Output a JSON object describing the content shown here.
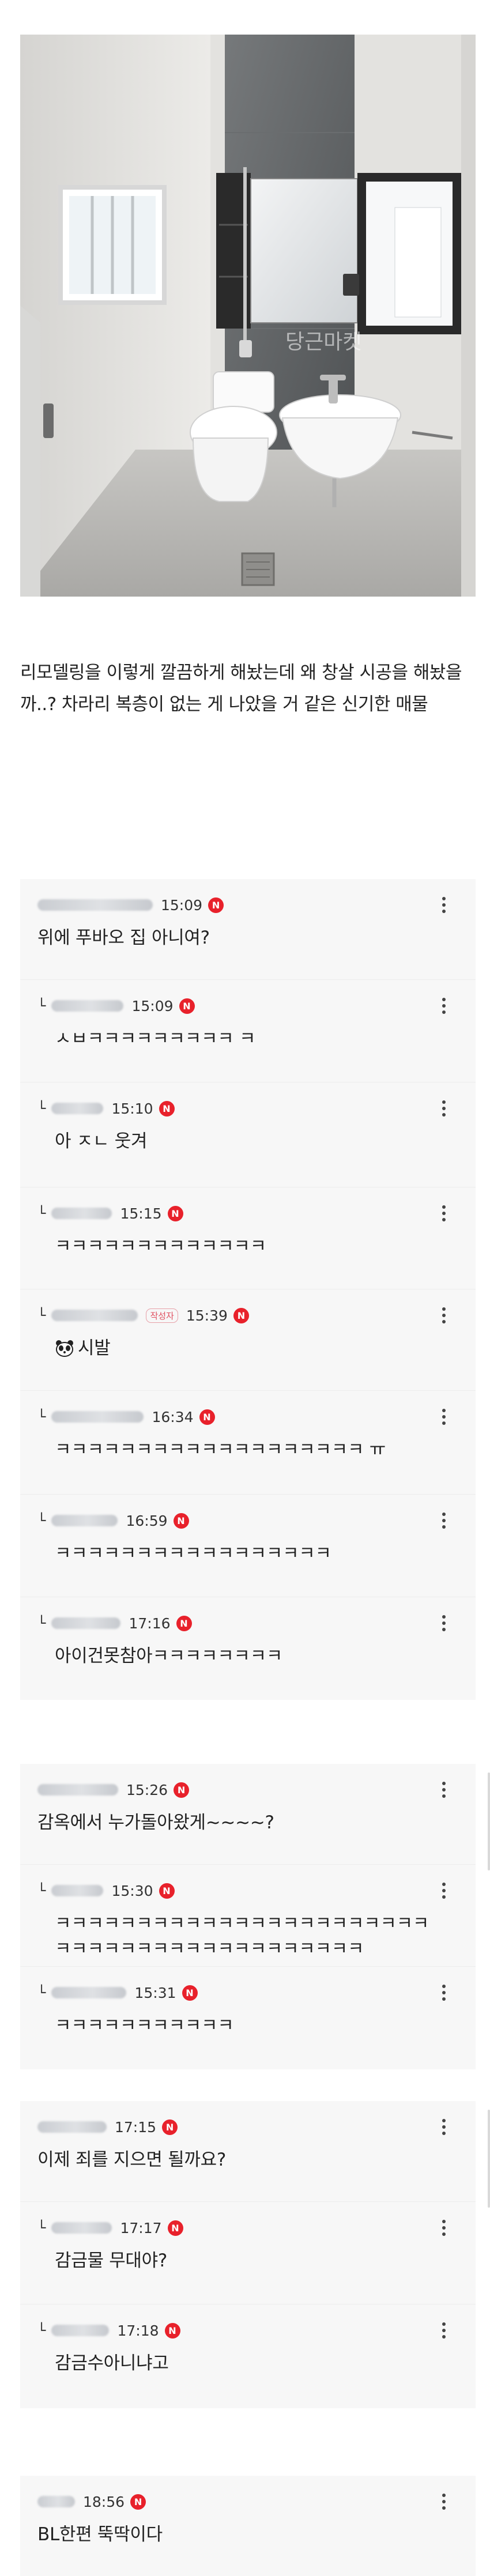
{
  "post": {
    "watermark": "당근마켓",
    "caption": "리모델링을 이렇게 깔끔하게 해놨는데 왜 창살 시공을 해놨을까..? 차라리 복층이 없는 게 나았을 거 같은 신기한 매물"
  },
  "threads": [
    {
      "comments": [
        {
          "reply": false,
          "time": "15:09",
          "badge": "",
          "text": "위에 푸바오 집 아니여?",
          "icon": "N"
        },
        {
          "reply": true,
          "time": "15:09",
          "badge": "",
          "text": "ㅅㅂㅋㅋㅋㅋㅋㅋㅋㅋㅋ ㅋ",
          "icon": "N"
        },
        {
          "reply": true,
          "time": "15:10",
          "badge": "",
          "text": "아 ㅈㄴ 웃겨",
          "icon": "N"
        },
        {
          "reply": true,
          "time": "15:15",
          "badge": "",
          "text": "ㅋㅋㅋㅋㅋㅋㅋㅋㅋㅋㅋㅋㅋ",
          "icon": "N"
        },
        {
          "reply": true,
          "time": "15:39",
          "badge": "작성자",
          "text": "시발",
          "emoji": "panda-emoji",
          "icon": "N"
        },
        {
          "reply": true,
          "time": "16:34",
          "badge": "",
          "text": "ㅋㅋㅋㅋㅋㅋㅋㅋㅋㅋㅋㅋㅋㅋㅋㅋㅋㅋㅋ ㅠ",
          "icon": "N"
        },
        {
          "reply": true,
          "time": "16:59",
          "badge": "",
          "text": "ㅋㅋㅋㅋㅋㅋㅋㅋㅋㅋㅋㅋㅋㅋㅋㅋㅋ",
          "icon": "N"
        },
        {
          "reply": true,
          "time": "17:16",
          "badge": "",
          "text": "아이건못참아ㅋㅋㅋㅋㅋㅋㅋㅋ",
          "icon": "N"
        }
      ]
    },
    {
      "comments": [
        {
          "reply": false,
          "time": "15:26",
          "badge": "",
          "text": "감옥에서 누가돌아왔게~~~~?",
          "icon": "N"
        },
        {
          "reply": true,
          "time": "15:30",
          "badge": "",
          "text": "ㅋㅋㅋㅋㅋㅋㅋㅋㅋㅋㅋㅋㅋㅋㅋㅋㅋㅋㅋㅋㅋㅋㅋㅋㅋㅋㅋㅋㅋㅋㅋㅋㅋㅋㅋㅋㅋㅋㅋㅋㅋㅋ",
          "icon": "N"
        },
        {
          "reply": true,
          "time": "15:31",
          "badge": "",
          "text": "ㅋㅋㅋㅋㅋㅋㅋㅋㅋㅋㅋ",
          "icon": "N"
        }
      ]
    },
    {
      "comments": [
        {
          "reply": false,
          "time": "17:15",
          "badge": "",
          "text": "이제 죄를 지으면 될까요?",
          "icon": "N"
        },
        {
          "reply": true,
          "time": "17:17",
          "badge": "",
          "text": "감금물 무대야?",
          "icon": "N"
        },
        {
          "reply": true,
          "time": "17:18",
          "badge": "",
          "text": "감금수아니냐고",
          "icon": "N"
        }
      ]
    },
    {
      "comments": [
        {
          "reply": false,
          "time": "18:56",
          "badge": "",
          "text": "BL한편 뚝딱이다",
          "icon": "N"
        }
      ]
    }
  ],
  "colors": {
    "n_badge": "#e8212b",
    "card_bg": "#f7f7f7",
    "author_badge": "#e05060"
  }
}
